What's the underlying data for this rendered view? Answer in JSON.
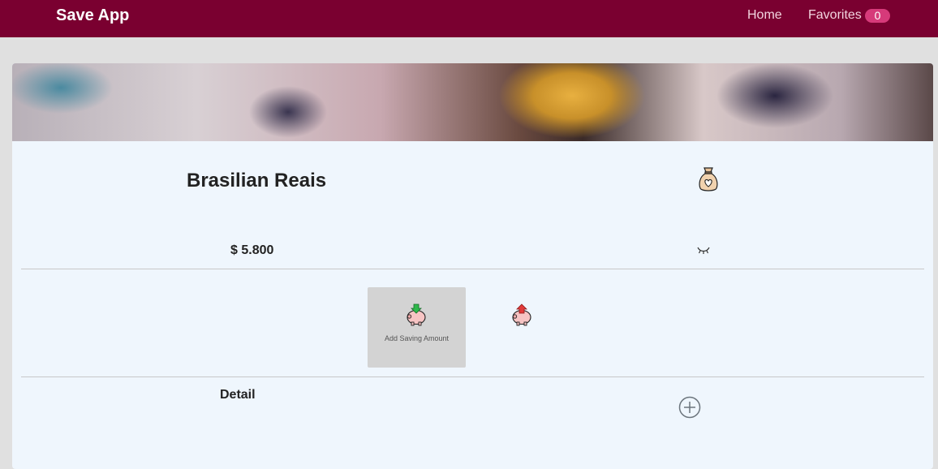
{
  "navbar": {
    "brand": "Save App",
    "home_label": "Home",
    "favorites_label": "Favorites",
    "favorites_count": "0",
    "background_color": "#7a0030",
    "badge_color": "#d63a7a"
  },
  "card": {
    "title": "Brasilian Reais",
    "amount": "$ 5.800",
    "add_saving_label": "Add Saving Amount",
    "detail_label": "Detail",
    "background_color": "#eff6fd",
    "icons": {
      "bag": "money-bag-icon",
      "visibility": "eye-closed-icon",
      "add_saving": "piggy-bank-deposit-icon",
      "withdraw": "piggy-bank-withdraw-icon",
      "add_detail": "plus-circle-icon"
    }
  }
}
